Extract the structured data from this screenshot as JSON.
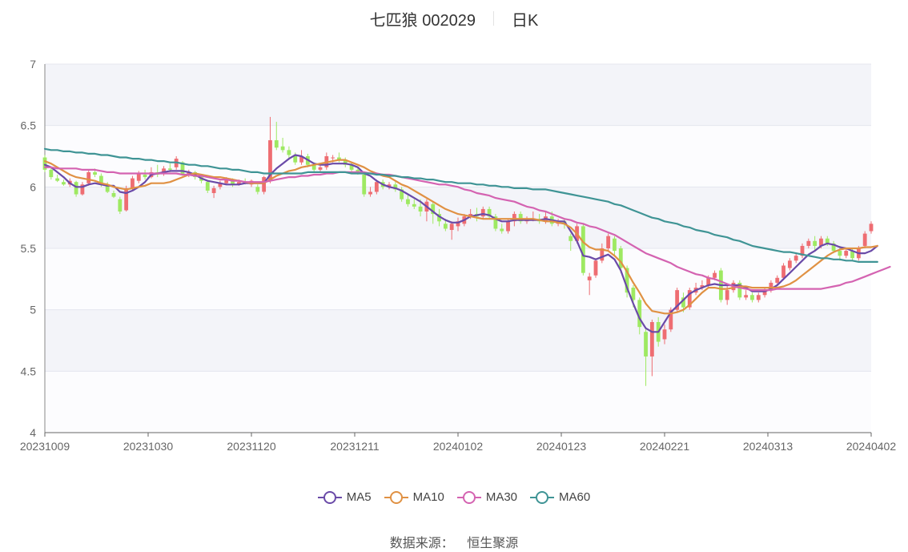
{
  "header": {
    "stock": "七匹狼 002029",
    "period": "日K"
  },
  "source": {
    "label": "数据来源：",
    "value": "恒生聚源"
  },
  "colors": {
    "up": "#ee6d72",
    "down": "#9ee962",
    "ma5": "#6a4aa8",
    "ma10": "#e09143",
    "ma30": "#d463b1",
    "ma60": "#3f9495"
  },
  "chart_data": {
    "type": "candlestick",
    "title": "七匹狼 002029 日K",
    "ylim": [
      4,
      7
    ],
    "yticks": [
      "4",
      "4.5",
      "5",
      "5.5",
      "6",
      "6.5",
      "7"
    ],
    "xticks": [
      "20231009",
      "20231030",
      "20231120",
      "20231211",
      "20240102",
      "20240123",
      "20240221",
      "20240313",
      "20240402"
    ],
    "grid": true,
    "legend_position": "bottom",
    "candles": [
      [
        6.24,
        6.14,
        6.26,
        6.12
      ],
      [
        6.14,
        6.08,
        6.16,
        6.06
      ],
      [
        6.07,
        6.05,
        6.1,
        6.04
      ],
      [
        6.04,
        6.02,
        6.06,
        6.01
      ],
      [
        6.02,
        6.05,
        6.07,
        6.0
      ],
      [
        6.04,
        5.94,
        6.05,
        5.92
      ],
      [
        5.94,
        6.02,
        6.04,
        5.93
      ],
      [
        6.03,
        6.12,
        6.14,
        6.01
      ],
      [
        6.12,
        6.1,
        6.15,
        6.08
      ],
      [
        6.09,
        6.02,
        6.11,
        6.0
      ],
      [
        6.02,
        5.96,
        6.04,
        5.95
      ],
      [
        5.95,
        5.92,
        5.97,
        5.91
      ],
      [
        5.9,
        5.8,
        5.92,
        5.78
      ],
      [
        5.81,
        5.99,
        6.01,
        5.8
      ],
      [
        5.99,
        6.07,
        6.09,
        5.97
      ],
      [
        6.05,
        6.11,
        6.13,
        6.03
      ],
      [
        6.1,
        6.08,
        6.14,
        6.06
      ],
      [
        6.08,
        6.12,
        6.16,
        6.07
      ],
      [
        6.12,
        6.1,
        6.18,
        6.08
      ],
      [
        6.11,
        6.15,
        6.17,
        6.09
      ],
      [
        6.15,
        6.14,
        6.19,
        6.12
      ],
      [
        6.16,
        6.23,
        6.25,
        6.14
      ],
      [
        6.2,
        6.1,
        6.21,
        6.09
      ],
      [
        6.1,
        6.12,
        6.14,
        6.08
      ],
      [
        6.12,
        6.08,
        6.13,
        6.06
      ],
      [
        6.08,
        6.05,
        6.1,
        6.03
      ],
      [
        6.04,
        5.97,
        6.05,
        5.95
      ],
      [
        5.95,
        5.99,
        6.01,
        5.91
      ],
      [
        6.0,
        6.03,
        6.05,
        5.98
      ],
      [
        6.03,
        6.06,
        6.08,
        6.02
      ],
      [
        6.05,
        6.02,
        6.07,
        6.0
      ],
      [
        6.02,
        6.04,
        6.06,
        6.01
      ],
      [
        6.04,
        6.03,
        6.07,
        6.02
      ],
      [
        6.02,
        6.05,
        6.06,
        6.0
      ],
      [
        6.0,
        5.96,
        6.02,
        5.94
      ],
      [
        5.96,
        6.08,
        6.09,
        5.94
      ],
      [
        6.05,
        6.38,
        6.57,
        6.03
      ],
      [
        6.38,
        6.32,
        6.53,
        6.3
      ],
      [
        6.33,
        6.3,
        6.4,
        6.28
      ],
      [
        6.3,
        6.26,
        6.33,
        6.22
      ],
      [
        6.26,
        6.2,
        6.28,
        6.18
      ],
      [
        6.2,
        6.25,
        6.3,
        6.18
      ],
      [
        6.25,
        6.18,
        6.27,
        6.16
      ],
      [
        6.18,
        6.14,
        6.2,
        6.12
      ],
      [
        6.14,
        6.16,
        6.18,
        6.12
      ],
      [
        6.16,
        6.25,
        6.28,
        6.14
      ],
      [
        6.24,
        6.24,
        6.26,
        6.2
      ],
      [
        6.24,
        6.22,
        6.28,
        6.2
      ],
      [
        6.22,
        6.18,
        6.24,
        6.16
      ],
      [
        6.18,
        6.14,
        6.2,
        6.12
      ],
      [
        6.14,
        6.12,
        6.16,
        6.1
      ],
      [
        6.1,
        5.94,
        6.12,
        5.92
      ],
      [
        5.94,
        5.96,
        6.0,
        5.92
      ],
      [
        5.96,
        6.04,
        6.06,
        5.94
      ],
      [
        6.04,
        6.0,
        6.06,
        5.98
      ],
      [
        6.0,
        6.02,
        6.04,
        5.98
      ],
      [
        6.02,
        5.98,
        6.04,
        5.96
      ],
      [
        5.98,
        5.9,
        6.0,
        5.88
      ],
      [
        5.9,
        5.86,
        5.94,
        5.84
      ],
      [
        5.86,
        5.84,
        5.9,
        5.82
      ],
      [
        5.84,
        5.8,
        5.9,
        5.76
      ],
      [
        5.8,
        5.88,
        5.9,
        5.72
      ],
      [
        5.86,
        5.78,
        5.88,
        5.7
      ],
      [
        5.78,
        5.72,
        5.82,
        5.68
      ],
      [
        5.7,
        5.66,
        5.74,
        5.64
      ],
      [
        5.65,
        5.7,
        5.72,
        5.57
      ],
      [
        5.68,
        5.72,
        5.75,
        5.64
      ],
      [
        5.7,
        5.76,
        5.78,
        5.68
      ],
      [
        5.76,
        5.78,
        5.82,
        5.74
      ],
      [
        5.78,
        5.76,
        5.83,
        5.72
      ],
      [
        5.76,
        5.82,
        5.84,
        5.74
      ],
      [
        5.82,
        5.76,
        5.84,
        5.74
      ],
      [
        5.76,
        5.66,
        5.78,
        5.64
      ],
      [
        5.66,
        5.64,
        5.7,
        5.62
      ],
      [
        5.64,
        5.72,
        5.74,
        5.62
      ],
      [
        5.72,
        5.78,
        5.8,
        5.68
      ],
      [
        5.78,
        5.72,
        5.8,
        5.7
      ],
      [
        5.72,
        5.74,
        5.76,
        5.7
      ],
      [
        5.74,
        5.74,
        5.8,
        5.72
      ],
      [
        5.74,
        5.72,
        5.78,
        5.7
      ],
      [
        5.72,
        5.76,
        5.8,
        5.7
      ],
      [
        5.76,
        5.7,
        5.8,
        5.68
      ],
      [
        5.7,
        5.72,
        5.74,
        5.68
      ],
      [
        5.72,
        5.7,
        5.74,
        5.66
      ],
      [
        5.6,
        5.56,
        5.62,
        5.48
      ],
      [
        5.56,
        5.68,
        5.7,
        5.54
      ],
      [
        5.68,
        5.3,
        5.7,
        5.28
      ],
      [
        5.24,
        5.27,
        5.3,
        5.12
      ],
      [
        5.28,
        5.4,
        5.42,
        5.26
      ],
      [
        5.4,
        5.5,
        5.54,
        5.38
      ],
      [
        5.5,
        5.6,
        5.62,
        5.48
      ],
      [
        5.58,
        5.48,
        5.6,
        5.44
      ],
      [
        5.5,
        5.34,
        5.52,
        5.3
      ],
      [
        5.34,
        5.14,
        5.36,
        5.1
      ],
      [
        5.18,
        5.08,
        5.2,
        5.02
      ],
      [
        5.08,
        4.86,
        5.1,
        4.8
      ],
      [
        4.82,
        4.62,
        4.86,
        4.38
      ],
      [
        4.62,
        4.9,
        4.92,
        4.46
      ],
      [
        4.9,
        4.74,
        4.94,
        4.7
      ],
      [
        4.76,
        4.84,
        4.88,
        4.72
      ],
      [
        4.84,
        5.0,
        5.02,
        4.82
      ],
      [
        5.0,
        5.16,
        5.18,
        4.98
      ],
      [
        5.1,
        5.02,
        5.14,
        4.98
      ],
      [
        5.02,
        5.16,
        5.18,
        5.0
      ],
      [
        5.14,
        5.18,
        5.22,
        5.12
      ],
      [
        5.18,
        5.2,
        5.24,
        5.16
      ],
      [
        5.2,
        5.26,
        5.28,
        5.18
      ],
      [
        5.26,
        5.3,
        5.32,
        5.24
      ],
      [
        5.32,
        5.08,
        5.34,
        5.06
      ],
      [
        5.08,
        5.16,
        5.2,
        5.04
      ],
      [
        5.16,
        5.22,
        5.24,
        5.14
      ],
      [
        5.22,
        5.1,
        5.24,
        5.08
      ],
      [
        5.1,
        5.12,
        5.16,
        5.08
      ],
      [
        5.12,
        5.08,
        5.14,
        5.06
      ],
      [
        5.08,
        5.12,
        5.14,
        5.06
      ],
      [
        5.12,
        5.16,
        5.18,
        5.1
      ],
      [
        5.16,
        5.22,
        5.24,
        5.14
      ],
      [
        5.22,
        5.26,
        5.28,
        5.2
      ],
      [
        5.26,
        5.36,
        5.38,
        5.24
      ],
      [
        5.34,
        5.4,
        5.42,
        5.32
      ],
      [
        5.4,
        5.44,
        5.46,
        5.38
      ],
      [
        5.44,
        5.52,
        5.54,
        5.42
      ],
      [
        5.52,
        5.56,
        5.58,
        5.5
      ],
      [
        5.56,
        5.52,
        5.6,
        5.48
      ],
      [
        5.52,
        5.58,
        5.6,
        5.5
      ],
      [
        5.58,
        5.54,
        5.6,
        5.52
      ],
      [
        5.54,
        5.48,
        5.56,
        5.46
      ],
      [
        5.48,
        5.44,
        5.52,
        5.4
      ],
      [
        5.44,
        5.48,
        5.5,
        5.42
      ],
      [
        5.48,
        5.42,
        5.5,
        5.4
      ],
      [
        5.42,
        5.5,
        5.52,
        5.4
      ],
      [
        5.52,
        5.62,
        5.64,
        5.5
      ],
      [
        5.64,
        5.7,
        5.72,
        5.62
      ]
    ],
    "series": [
      {
        "name": "MA5",
        "values": [
          6.18,
          6.16,
          6.12,
          6.08,
          6.03,
          6.0,
          6.0,
          6.02,
          6.03,
          6.02,
          6.01,
          6.01,
          5.96,
          5.95,
          5.97,
          6.0,
          6.04,
          6.1,
          6.11,
          6.12,
          6.13,
          6.13,
          6.13,
          6.12,
          6.1,
          6.07,
          6.05,
          6.04,
          6.03,
          6.02,
          6.02,
          6.02,
          6.03,
          6.03,
          6.03,
          6.03,
          6.1,
          6.15,
          6.19,
          6.23,
          6.26,
          6.25,
          6.22,
          6.19,
          6.18,
          6.18,
          6.19,
          6.19,
          6.19,
          6.18,
          6.16,
          6.11,
          6.09,
          6.05,
          6.02,
          6.0,
          5.99,
          5.97,
          5.94,
          5.91,
          5.88,
          5.84,
          5.8,
          5.76,
          5.73,
          5.71,
          5.71,
          5.73,
          5.76,
          5.77,
          5.78,
          5.77,
          5.74,
          5.72,
          5.72,
          5.73,
          5.73,
          5.73,
          5.73,
          5.73,
          5.74,
          5.73,
          5.72,
          5.72,
          5.64,
          5.56,
          5.44,
          5.43,
          5.41,
          5.43,
          5.45,
          5.41,
          5.32,
          5.18,
          5.05,
          4.93,
          4.85,
          4.82,
          4.82,
          4.9,
          4.98,
          5.03,
          5.08,
          5.13,
          5.16,
          5.18,
          5.2,
          5.21,
          5.2,
          5.2,
          5.2,
          5.2,
          5.18,
          5.15,
          5.15,
          5.15,
          5.17,
          5.2,
          5.25,
          5.3,
          5.35,
          5.4,
          5.45,
          5.48,
          5.52,
          5.54,
          5.53,
          5.51,
          5.5,
          5.48,
          5.46,
          5.46,
          5.48,
          5.52
        ]
      },
      {
        "name": "MA10",
        "values": [
          6.21,
          6.19,
          6.16,
          6.13,
          6.1,
          6.08,
          6.07,
          6.06,
          6.05,
          6.03,
          6.02,
          6.0,
          5.99,
          5.98,
          5.99,
          6.0,
          6.01,
          6.03,
          6.03,
          6.03,
          6.04,
          6.06,
          6.08,
          6.1,
          6.11,
          6.1,
          6.09,
          6.08,
          6.08,
          6.07,
          6.06,
          6.05,
          6.04,
          6.03,
          6.03,
          6.03,
          6.06,
          6.09,
          6.11,
          6.13,
          6.14,
          6.16,
          6.17,
          6.18,
          6.19,
          6.2,
          6.21,
          6.22,
          6.22,
          6.2,
          6.18,
          6.16,
          6.13,
          6.11,
          6.09,
          6.08,
          6.05,
          6.02,
          6.0,
          5.97,
          5.94,
          5.91,
          5.88,
          5.85,
          5.82,
          5.8,
          5.78,
          5.77,
          5.76,
          5.75,
          5.74,
          5.74,
          5.74,
          5.74,
          5.74,
          5.74,
          5.74,
          5.74,
          5.74,
          5.73,
          5.72,
          5.72,
          5.71,
          5.7,
          5.67,
          5.62,
          5.55,
          5.51,
          5.49,
          5.49,
          5.48,
          5.44,
          5.39,
          5.31,
          5.22,
          5.14,
          5.05,
          4.99,
          4.98,
          4.97,
          4.97,
          4.98,
          5.0,
          5.04,
          5.09,
          5.14,
          5.18,
          5.18,
          5.17,
          5.17,
          5.18,
          5.19,
          5.19,
          5.18,
          5.18,
          5.18,
          5.18,
          5.18,
          5.19,
          5.21,
          5.24,
          5.28,
          5.32,
          5.36,
          5.4,
          5.44,
          5.47,
          5.49,
          5.5,
          5.5,
          5.5,
          5.51,
          5.51,
          5.52
        ]
      },
      {
        "name": "MA30",
        "values": [
          6.16,
          6.16,
          6.15,
          6.15,
          6.15,
          6.15,
          6.14,
          6.14,
          6.14,
          6.13,
          6.12,
          6.12,
          6.11,
          6.11,
          6.11,
          6.11,
          6.11,
          6.11,
          6.11,
          6.11,
          6.11,
          6.11,
          6.1,
          6.1,
          6.09,
          6.09,
          6.08,
          6.07,
          6.06,
          6.06,
          6.05,
          6.05,
          6.04,
          6.04,
          6.04,
          6.04,
          6.05,
          6.06,
          6.07,
          6.08,
          6.08,
          6.09,
          6.09,
          6.1,
          6.1,
          6.11,
          6.11,
          6.12,
          6.12,
          6.12,
          6.12,
          6.12,
          6.11,
          6.11,
          6.1,
          6.1,
          6.09,
          6.08,
          6.07,
          6.06,
          6.05,
          6.04,
          6.03,
          6.02,
          6.02,
          6.01,
          6.0,
          5.98,
          5.97,
          5.95,
          5.94,
          5.93,
          5.91,
          5.9,
          5.89,
          5.88,
          5.86,
          5.84,
          5.83,
          5.81,
          5.8,
          5.78,
          5.76,
          5.74,
          5.73,
          5.71,
          5.7,
          5.68,
          5.67,
          5.65,
          5.63,
          5.61,
          5.58,
          5.55,
          5.52,
          5.49,
          5.46,
          5.44,
          5.42,
          5.4,
          5.38,
          5.35,
          5.33,
          5.31,
          5.29,
          5.28,
          5.26,
          5.25,
          5.23,
          5.21,
          5.19,
          5.18,
          5.17,
          5.16,
          5.16,
          5.16,
          5.16,
          5.17,
          5.17,
          5.17,
          5.17,
          5.17,
          5.17,
          5.17,
          5.17,
          5.18,
          5.19,
          5.2,
          5.22,
          5.23,
          5.25,
          5.27,
          5.29,
          5.31,
          5.33,
          5.35
        ]
      },
      {
        "name": "MA60",
        "values": [
          6.31,
          6.3,
          6.3,
          6.29,
          6.29,
          6.28,
          6.28,
          6.27,
          6.27,
          6.26,
          6.26,
          6.25,
          6.24,
          6.24,
          6.23,
          6.23,
          6.22,
          6.22,
          6.21,
          6.21,
          6.2,
          6.2,
          6.19,
          6.18,
          6.18,
          6.17,
          6.17,
          6.16,
          6.15,
          6.15,
          6.14,
          6.14,
          6.13,
          6.12,
          6.12,
          6.11,
          6.11,
          6.11,
          6.11,
          6.11,
          6.11,
          6.11,
          6.12,
          6.12,
          6.12,
          6.12,
          6.12,
          6.12,
          6.12,
          6.11,
          6.11,
          6.11,
          6.11,
          6.1,
          6.1,
          6.09,
          6.09,
          6.08,
          6.08,
          6.07,
          6.07,
          6.06,
          6.06,
          6.05,
          6.04,
          6.04,
          6.03,
          6.03,
          6.03,
          6.02,
          6.02,
          6.01,
          6.01,
          6.0,
          6.0,
          5.99,
          5.99,
          5.99,
          5.98,
          5.98,
          5.98,
          5.97,
          5.96,
          5.95,
          5.94,
          5.93,
          5.92,
          5.91,
          5.9,
          5.89,
          5.88,
          5.86,
          5.85,
          5.83,
          5.81,
          5.79,
          5.77,
          5.75,
          5.74,
          5.72,
          5.71,
          5.7,
          5.68,
          5.67,
          5.65,
          5.64,
          5.63,
          5.61,
          5.6,
          5.59,
          5.57,
          5.56,
          5.54,
          5.52,
          5.51,
          5.5,
          5.49,
          5.48,
          5.47,
          5.47,
          5.46,
          5.45,
          5.44,
          5.43,
          5.42,
          5.42,
          5.41,
          5.41,
          5.4,
          5.4,
          5.39,
          5.39,
          5.39,
          5.39
        ]
      }
    ]
  }
}
